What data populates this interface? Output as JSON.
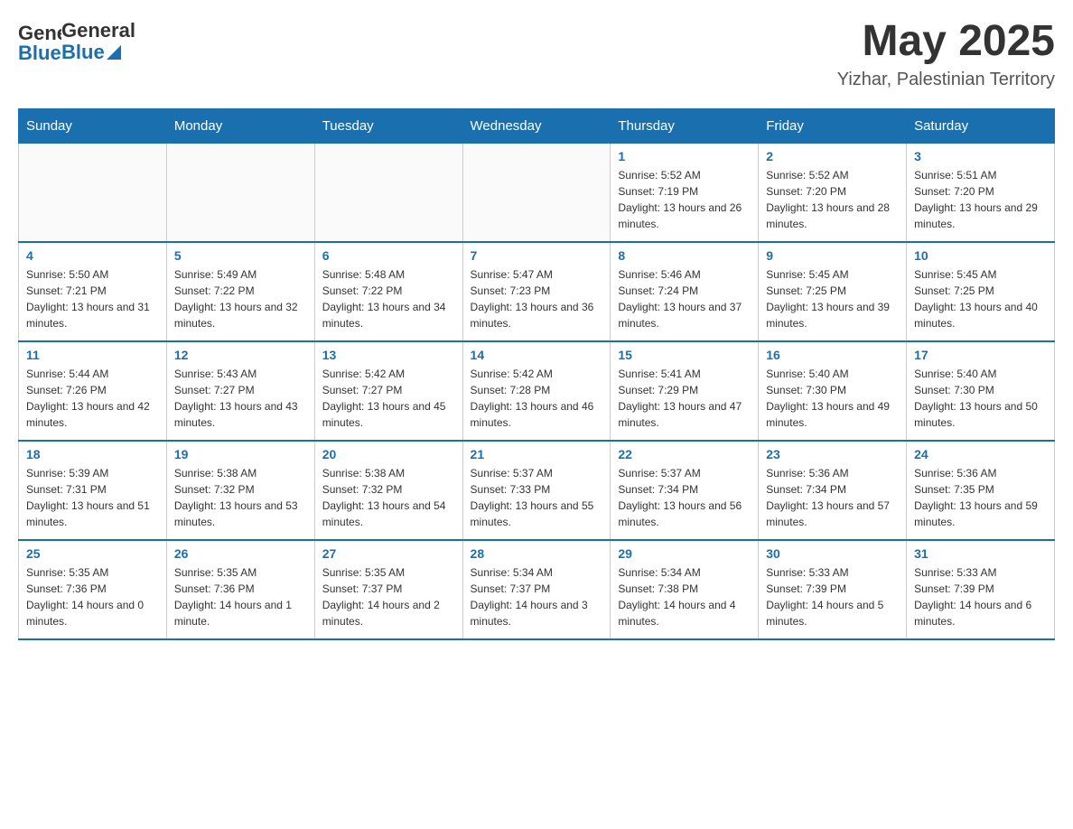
{
  "header": {
    "logo_general": "General",
    "logo_blue": "Blue",
    "month_title": "May 2025",
    "location": "Yizhar, Palestinian Territory"
  },
  "days_of_week": [
    "Sunday",
    "Monday",
    "Tuesday",
    "Wednesday",
    "Thursday",
    "Friday",
    "Saturday"
  ],
  "weeks": [
    [
      {
        "day": "",
        "info": ""
      },
      {
        "day": "",
        "info": ""
      },
      {
        "day": "",
        "info": ""
      },
      {
        "day": "",
        "info": ""
      },
      {
        "day": "1",
        "info": "Sunrise: 5:52 AM\nSunset: 7:19 PM\nDaylight: 13 hours and 26 minutes."
      },
      {
        "day": "2",
        "info": "Sunrise: 5:52 AM\nSunset: 7:20 PM\nDaylight: 13 hours and 28 minutes."
      },
      {
        "day": "3",
        "info": "Sunrise: 5:51 AM\nSunset: 7:20 PM\nDaylight: 13 hours and 29 minutes."
      }
    ],
    [
      {
        "day": "4",
        "info": "Sunrise: 5:50 AM\nSunset: 7:21 PM\nDaylight: 13 hours and 31 minutes."
      },
      {
        "day": "5",
        "info": "Sunrise: 5:49 AM\nSunset: 7:22 PM\nDaylight: 13 hours and 32 minutes."
      },
      {
        "day": "6",
        "info": "Sunrise: 5:48 AM\nSunset: 7:22 PM\nDaylight: 13 hours and 34 minutes."
      },
      {
        "day": "7",
        "info": "Sunrise: 5:47 AM\nSunset: 7:23 PM\nDaylight: 13 hours and 36 minutes."
      },
      {
        "day": "8",
        "info": "Sunrise: 5:46 AM\nSunset: 7:24 PM\nDaylight: 13 hours and 37 minutes."
      },
      {
        "day": "9",
        "info": "Sunrise: 5:45 AM\nSunset: 7:25 PM\nDaylight: 13 hours and 39 minutes."
      },
      {
        "day": "10",
        "info": "Sunrise: 5:45 AM\nSunset: 7:25 PM\nDaylight: 13 hours and 40 minutes."
      }
    ],
    [
      {
        "day": "11",
        "info": "Sunrise: 5:44 AM\nSunset: 7:26 PM\nDaylight: 13 hours and 42 minutes."
      },
      {
        "day": "12",
        "info": "Sunrise: 5:43 AM\nSunset: 7:27 PM\nDaylight: 13 hours and 43 minutes."
      },
      {
        "day": "13",
        "info": "Sunrise: 5:42 AM\nSunset: 7:27 PM\nDaylight: 13 hours and 45 minutes."
      },
      {
        "day": "14",
        "info": "Sunrise: 5:42 AM\nSunset: 7:28 PM\nDaylight: 13 hours and 46 minutes."
      },
      {
        "day": "15",
        "info": "Sunrise: 5:41 AM\nSunset: 7:29 PM\nDaylight: 13 hours and 47 minutes."
      },
      {
        "day": "16",
        "info": "Sunrise: 5:40 AM\nSunset: 7:30 PM\nDaylight: 13 hours and 49 minutes."
      },
      {
        "day": "17",
        "info": "Sunrise: 5:40 AM\nSunset: 7:30 PM\nDaylight: 13 hours and 50 minutes."
      }
    ],
    [
      {
        "day": "18",
        "info": "Sunrise: 5:39 AM\nSunset: 7:31 PM\nDaylight: 13 hours and 51 minutes."
      },
      {
        "day": "19",
        "info": "Sunrise: 5:38 AM\nSunset: 7:32 PM\nDaylight: 13 hours and 53 minutes."
      },
      {
        "day": "20",
        "info": "Sunrise: 5:38 AM\nSunset: 7:32 PM\nDaylight: 13 hours and 54 minutes."
      },
      {
        "day": "21",
        "info": "Sunrise: 5:37 AM\nSunset: 7:33 PM\nDaylight: 13 hours and 55 minutes."
      },
      {
        "day": "22",
        "info": "Sunrise: 5:37 AM\nSunset: 7:34 PM\nDaylight: 13 hours and 56 minutes."
      },
      {
        "day": "23",
        "info": "Sunrise: 5:36 AM\nSunset: 7:34 PM\nDaylight: 13 hours and 57 minutes."
      },
      {
        "day": "24",
        "info": "Sunrise: 5:36 AM\nSunset: 7:35 PM\nDaylight: 13 hours and 59 minutes."
      }
    ],
    [
      {
        "day": "25",
        "info": "Sunrise: 5:35 AM\nSunset: 7:36 PM\nDaylight: 14 hours and 0 minutes."
      },
      {
        "day": "26",
        "info": "Sunrise: 5:35 AM\nSunset: 7:36 PM\nDaylight: 14 hours and 1 minute."
      },
      {
        "day": "27",
        "info": "Sunrise: 5:35 AM\nSunset: 7:37 PM\nDaylight: 14 hours and 2 minutes."
      },
      {
        "day": "28",
        "info": "Sunrise: 5:34 AM\nSunset: 7:37 PM\nDaylight: 14 hours and 3 minutes."
      },
      {
        "day": "29",
        "info": "Sunrise: 5:34 AM\nSunset: 7:38 PM\nDaylight: 14 hours and 4 minutes."
      },
      {
        "day": "30",
        "info": "Sunrise: 5:33 AM\nSunset: 7:39 PM\nDaylight: 14 hours and 5 minutes."
      },
      {
        "day": "31",
        "info": "Sunrise: 5:33 AM\nSunset: 7:39 PM\nDaylight: 14 hours and 6 minutes."
      }
    ]
  ]
}
